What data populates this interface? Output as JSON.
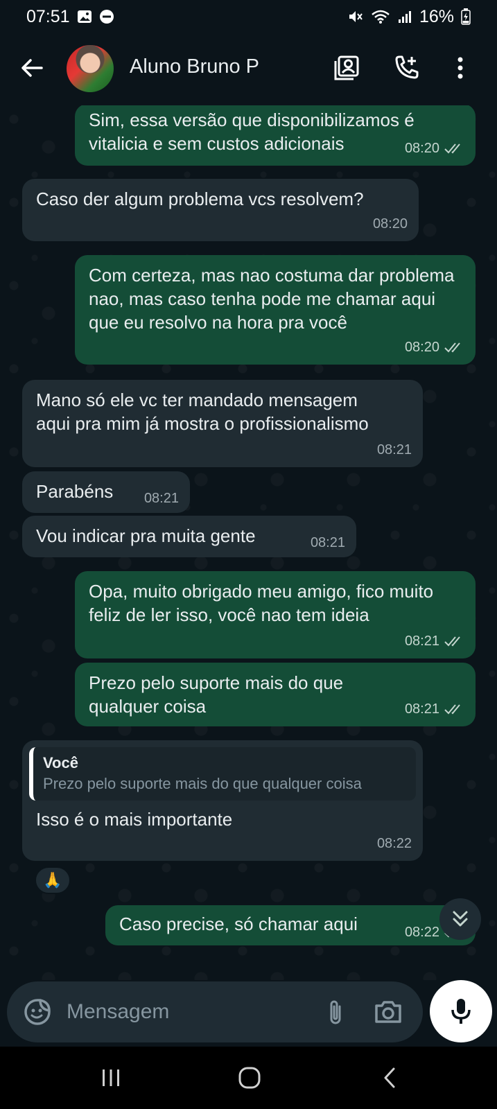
{
  "status_bar": {
    "time": "07:51",
    "battery": "16%"
  },
  "header": {
    "contact_name": "Aluno Bruno P"
  },
  "messages": [
    {
      "direction": "out",
      "text": "Sim, essa versão que disponibilizamos é vitalicia e sem custos adicionais",
      "time": "08:20",
      "read": true
    },
    {
      "direction": "in",
      "text": "Caso der algum problema vcs resolvem?",
      "time": "08:20"
    },
    {
      "direction": "out",
      "text": "Com certeza, mas nao costuma dar problema nao, mas caso tenha pode me chamar aqui que eu resolvo na hora pra você",
      "time": "08:20",
      "read": true
    },
    {
      "direction": "in",
      "text": "Mano só ele vc ter mandado mensagem aqui pra mim já mostra o profissionalismo",
      "time": "08:21"
    },
    {
      "direction": "in",
      "text": "Parabéns",
      "time": "08:21"
    },
    {
      "direction": "in",
      "text": "Vou indicar pra muita gente",
      "time": "08:21"
    },
    {
      "direction": "out",
      "text": "Opa, muito obrigado meu amigo, fico muito feliz de ler isso, você nao tem ideia",
      "time": "08:21",
      "read": true
    },
    {
      "direction": "out",
      "text": "Prezo pelo suporte mais do que qualquer coisa",
      "time": "08:21",
      "read": true
    },
    {
      "direction": "in",
      "quote_author": "Você",
      "quote_text": "Prezo pelo suporte mais do que qualquer coisa",
      "text": "Isso é o mais importante",
      "time": "08:22",
      "reaction": "🙏"
    },
    {
      "direction": "out",
      "text": "Caso precise, só chamar aqui",
      "time": "08:22",
      "read": true
    }
  ],
  "input": {
    "placeholder": "Mensagem"
  },
  "colors": {
    "outgoing_bubble": "#144d37",
    "incoming_bubble": "#202c33",
    "background": "#0b141a",
    "read_ticks": "#c5d6cf"
  },
  "icons": {
    "back": "arrow-left-icon",
    "contact_card": "contact-card-icon",
    "add_call": "phone-plus-icon",
    "menu": "more-vertical-icon",
    "emoji": "sticker-smile-icon",
    "attach": "paperclip-icon",
    "camera": "camera-icon",
    "mic": "microphone-icon",
    "scroll": "chevrons-down-icon"
  }
}
